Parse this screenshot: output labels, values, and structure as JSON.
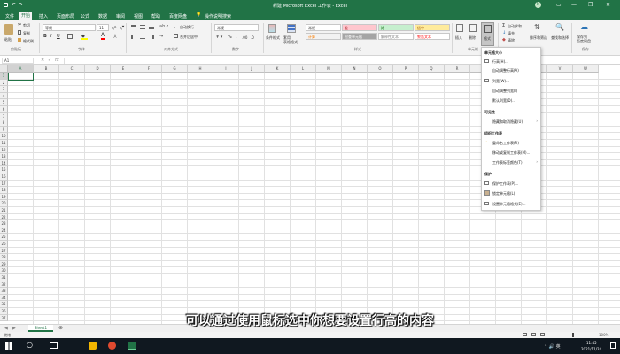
{
  "window": {
    "title": "新建 Microsoft Excel 工作表 - Excel",
    "user": "k"
  },
  "tabs": [
    "文件",
    "开始",
    "插入",
    "页面布局",
    "公式",
    "数据",
    "审阅",
    "视图",
    "帮助",
    "百度网盘"
  ],
  "active_tab": "开始",
  "tell_me": "操作说明搜索",
  "ribbon": {
    "clipboard": {
      "label": "剪贴板",
      "paste": "粘贴",
      "cut": "剪切",
      "copy": "复制",
      "format_painter": "格式刷"
    },
    "font": {
      "label": "字体",
      "name": "等线",
      "size": "11"
    },
    "alignment": {
      "label": "对齐方式",
      "wrap": "自动换行",
      "merge": "合并后居中"
    },
    "number": {
      "label": "数字",
      "format": "常规"
    },
    "styles": {
      "label": "样式",
      "conditional": "条件格式",
      "table": "套用\n表格格式",
      "cells": [
        {
          "text": "常规",
          "bg": "#ffffff",
          "fg": "#222222"
        },
        {
          "text": "差",
          "bg": "#ffc7ce",
          "fg": "#9c0006"
        },
        {
          "text": "好",
          "bg": "#c6efce",
          "fg": "#006100"
        },
        {
          "text": "适中",
          "bg": "#ffeb9c",
          "fg": "#9c5700"
        },
        {
          "text": "计算",
          "bg": "#f2f2f2",
          "fg": "#fa7d00"
        },
        {
          "text": "检查单元格",
          "bg": "#a5a5a5",
          "fg": "#ffffff"
        },
        {
          "text": "解释性文本",
          "bg": "#ffffff",
          "fg": "#7f7f7f"
        },
        {
          "text": "警告文本",
          "bg": "#ffffff",
          "fg": "#ff0000"
        }
      ]
    },
    "cells_group": {
      "label": "单元格",
      "insert": "插入",
      "delete": "删除",
      "format": "格式"
    },
    "editing": {
      "label": "编辑",
      "autosum": "自动求和",
      "fill": "填充",
      "clear": "清除",
      "sort": "排序和筛选",
      "find": "查找和选择"
    },
    "save": {
      "label": "保存",
      "btn": "保存到\n百度网盘"
    }
  },
  "name_box": "A1",
  "columns": [
    "A",
    "B",
    "C",
    "D",
    "E",
    "F",
    "G",
    "H",
    "I",
    "J",
    "K",
    "L",
    "M",
    "N",
    "O",
    "P",
    "Q",
    "R",
    "S",
    "T",
    "U",
    "V",
    "W"
  ],
  "rows": [
    "1",
    "2",
    "3",
    "4",
    "5",
    "6",
    "7",
    "8",
    "9",
    "10",
    "11",
    "12",
    "13",
    "14",
    "15",
    "16",
    "17",
    "18",
    "19",
    "20",
    "21",
    "22",
    "23",
    "24",
    "25",
    "26",
    "27",
    "28",
    "29",
    "30",
    "31",
    "32",
    "33",
    "34",
    "35",
    "36",
    "37"
  ],
  "sheet_tab": "Sheet1",
  "status": "就绪",
  "zoom": "100%",
  "menu": {
    "section_size": "单元格大小",
    "row_height": "行高(H)...",
    "autofit_row": "自动调整行高(A)",
    "col_width": "列宽(W)...",
    "autofit_col": "自动调整列宽(I)",
    "default_width": "默认列宽(D)...",
    "section_visibility": "可见性",
    "hide_unhide": "隐藏和取消隐藏(U)",
    "section_organize": "组织工作表",
    "rename": "重命名工作表(R)",
    "move_copy": "移动或复制工作表(M)...",
    "tab_color": "工作表标签颜色(T)",
    "section_protect": "保护",
    "protect_sheet": "保护工作表(P)...",
    "lock_cell": "锁定单元格(L)",
    "format_cells": "设置单元格格式(E)..."
  },
  "taskbar": {
    "time": "11:45",
    "date": "2021/11/24"
  },
  "subtitle": "可以通过使用鼠标选中你想要设置行高的内容",
  "colors": {
    "excel_green": "#217346",
    "ribbon_bg": "#f3f3f3",
    "taskbar": "#101820"
  }
}
